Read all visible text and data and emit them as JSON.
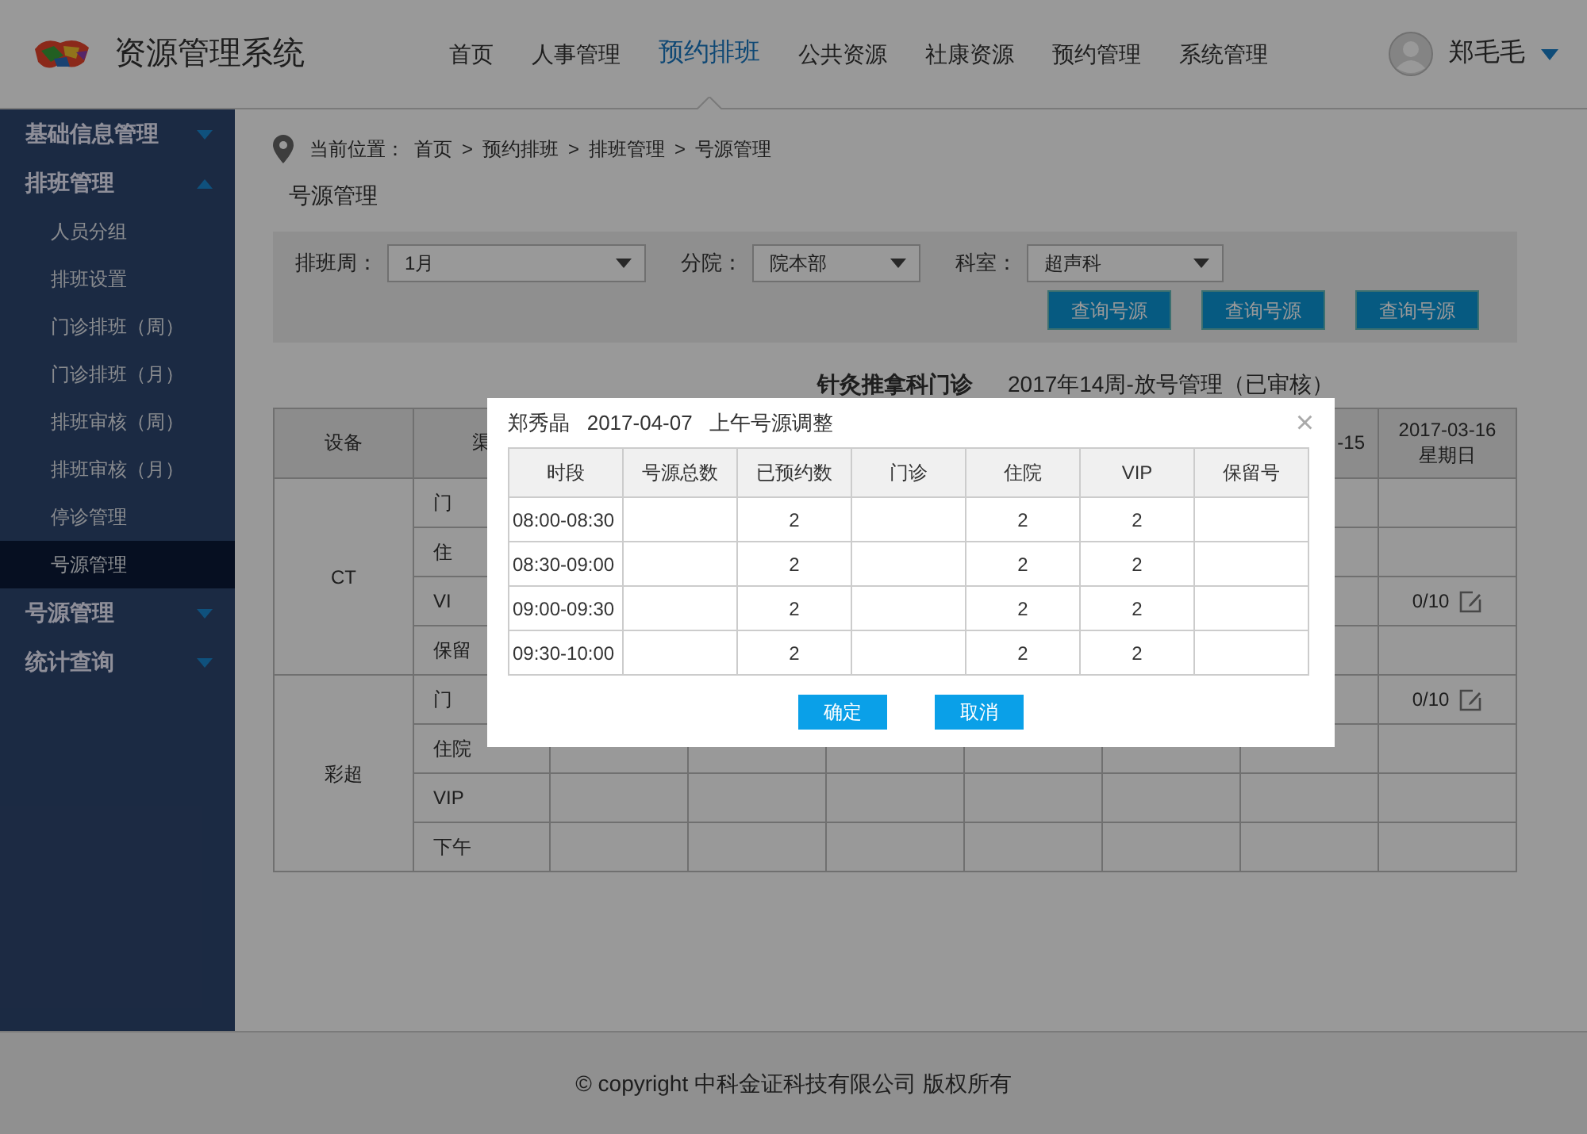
{
  "header": {
    "title": "资源管理系统",
    "nav": [
      {
        "label": "首页",
        "selected": false
      },
      {
        "label": "人事管理",
        "selected": false
      },
      {
        "label": "预约排班",
        "selected": true
      },
      {
        "label": "公共资源",
        "selected": false
      },
      {
        "label": "社康资源",
        "selected": false
      },
      {
        "label": "预约管理",
        "selected": false
      },
      {
        "label": "系统管理",
        "selected": false
      }
    ],
    "user": {
      "name": "郑毛毛"
    }
  },
  "sidebar": {
    "items": [
      {
        "label": "基础信息管理",
        "expanded": false
      },
      {
        "label": "排班管理",
        "expanded": true,
        "children": [
          {
            "label": "人员分组",
            "selected": false
          },
          {
            "label": "排班设置",
            "selected": false
          },
          {
            "label": "门诊排班（周）",
            "selected": false
          },
          {
            "label": "门诊排班（月）",
            "selected": false
          },
          {
            "label": "排班审核（周）",
            "selected": false
          },
          {
            "label": "排班审核（月）",
            "selected": false
          },
          {
            "label": "停诊管理",
            "selected": false
          },
          {
            "label": "号源管理",
            "selected": true
          }
        ]
      },
      {
        "label": "号源管理",
        "expanded": false
      },
      {
        "label": "统计查询",
        "expanded": false
      }
    ]
  },
  "breadcrumb": {
    "label": "当前位置：",
    "separator": ">",
    "items": [
      "首页",
      "预约排班",
      "排班管理",
      "号源管理"
    ]
  },
  "page_title": "号源管理",
  "filters": [
    {
      "label": "排班周：",
      "value": "1月"
    },
    {
      "label": "分院：",
      "value": "院本部"
    },
    {
      "label": "科室：",
      "value": "超声科"
    }
  ],
  "buttons": [
    "查询号源",
    "查询号源",
    "查询号源"
  ],
  "schedule": {
    "department": "针灸推拿科门诊",
    "subtitle": "2017年14周-放号管理（已审核）",
    "columns": [
      {
        "label": "设备"
      },
      {
        "label": "渠"
      },
      {
        "label": "-15"
      },
      {
        "date": "2017-03-16",
        "weekday": "星期日"
      }
    ],
    "groups": [
      {
        "device": "CT",
        "rows": [
          {
            "channel": "门"
          },
          {
            "channel": "住"
          },
          {
            "channel": "VI",
            "quota": "0/10"
          },
          {
            "channel": "保留"
          }
        ]
      },
      {
        "device": "彩超",
        "rows": [
          {
            "channel": "门",
            "quota": "0/10"
          },
          {
            "channel": "住院"
          },
          {
            "channel": "VIP"
          },
          {
            "channel": "下午"
          }
        ]
      }
    ]
  },
  "dialog": {
    "title": "郑秀晶   2017-04-07   上午号源调整",
    "close": "×",
    "columns": [
      "时段",
      "号源总数",
      "已预约数",
      "门诊",
      "住院",
      "VIP",
      "保留号"
    ],
    "rows": [
      {
        "time": "08:00-08:30",
        "booked": "2",
        "inpatient": "2",
        "vip": "2"
      },
      {
        "time": "08:30-09:00",
        "booked": "2",
        "inpatient": "2",
        "vip": "2"
      },
      {
        "time": "09:00-09:30",
        "booked": "2",
        "inpatient": "2",
        "vip": "2"
      },
      {
        "time": "09:30-10:00",
        "booked": "2",
        "inpatient": "2",
        "vip": "2"
      }
    ],
    "buttons": [
      "确定",
      "取消"
    ]
  },
  "footer": "© copyright 中科金证科技有限公司 版权所有"
}
